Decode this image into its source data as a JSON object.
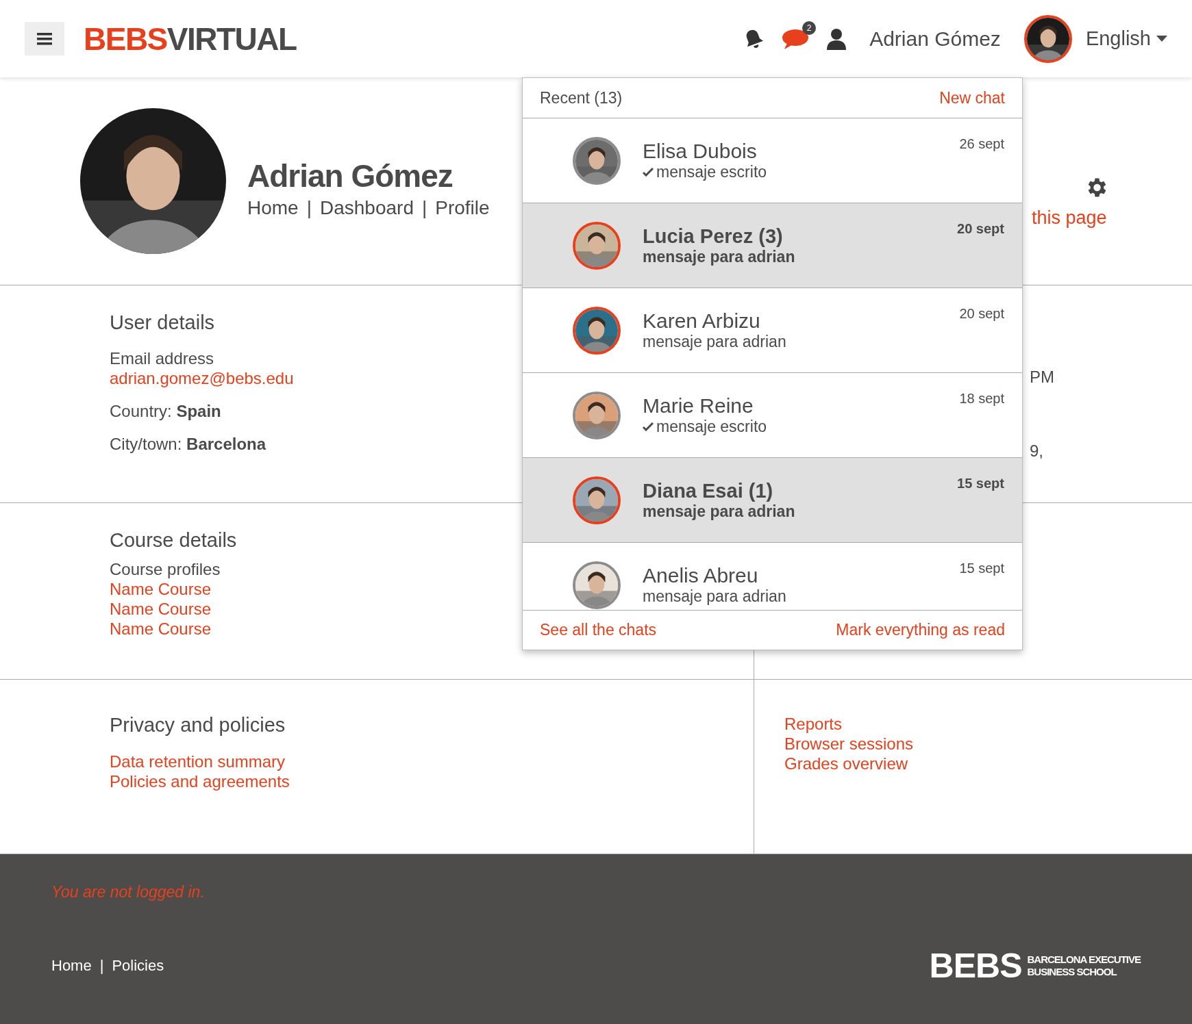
{
  "header": {
    "logo": {
      "first": "BEBS",
      "second": "VIRTUAL"
    },
    "chat_badge": "2",
    "user_name": "Adrian Gómez",
    "language": "English"
  },
  "profile": {
    "name": "Adrian Gómez",
    "breadcrumb": [
      {
        "label": "Home"
      },
      {
        "separator": "|",
        "label": "Dashboard"
      },
      {
        "separator": "|",
        "label": "Profile"
      }
    ],
    "page_action": "this page"
  },
  "user_details": {
    "title": "User details",
    "email_label": "Email address",
    "email": "adrian.gomez@bebs.edu",
    "fields": [
      {
        "label": "Country:",
        "value": "Spain"
      },
      {
        "label": "City/town:",
        "value": "Barcelona"
      }
    ],
    "side_texts": [
      "PM",
      "9,"
    ]
  },
  "course_details": {
    "title": "Course details",
    "subtitle": "Course profiles",
    "courses": [
      "Name Course",
      "Name Course",
      "Name Course"
    ]
  },
  "privacy": {
    "title": "Privacy and policies",
    "links": [
      "Data retention summary",
      "Policies and agreements"
    ]
  },
  "reports": {
    "links": [
      "Reports",
      "Browser sessions",
      "Grades overview"
    ]
  },
  "chat_dropdown": {
    "title": "Recent (13)",
    "new_chat": "New chat",
    "chats": [
      {
        "name": "Elisa Dubois",
        "message": "mensaje escrito",
        "date": "26 sept",
        "unread": false,
        "sent": true,
        "color": "#8c8c8c"
      },
      {
        "name": "Lucia Perez (3)",
        "message": "mensaje para adrian",
        "date": "20 sept",
        "unread": true,
        "sent": false,
        "color": "#e8401c"
      },
      {
        "name": "Karen Arbizu",
        "message": "mensaje para adrian",
        "date": "20 sept",
        "unread": false,
        "sent": false,
        "color": "#e8401c"
      },
      {
        "name": "Marie Reine",
        "message": "mensaje escrito",
        "date": "18 sept",
        "unread": false,
        "sent": true,
        "color": "#8c8c8c"
      },
      {
        "name": "Diana Esai (1)",
        "message": "mensaje para adrian",
        "date": "15 sept",
        "unread": true,
        "sent": false,
        "color": "#e8401c"
      },
      {
        "name": "Anelis Abreu",
        "message": "mensaje para adrian",
        "date": "15 sept",
        "unread": false,
        "sent": false,
        "color": "#8c8c8c"
      }
    ],
    "see_all": "See all the chats",
    "mark_read": "Mark everything as read"
  },
  "footer": {
    "status": "You are not logged in.",
    "links": [
      {
        "label": "Home"
      },
      {
        "separator": "|",
        "label": "Policies"
      }
    ],
    "logo": {
      "big": "BEBS",
      "line1": "BARCELONA EXECUTIVE",
      "line2": "BUSINESS SCHOOL"
    }
  }
}
